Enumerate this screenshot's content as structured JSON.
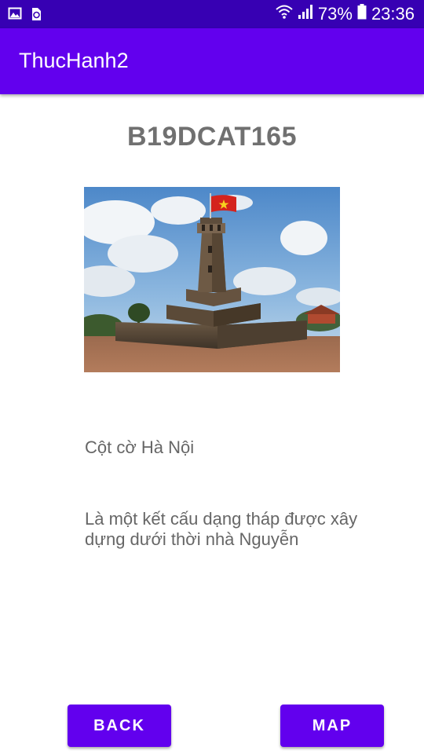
{
  "status_bar": {
    "battery_percent": "73%",
    "time": "23:36",
    "icons": [
      "image-icon",
      "recycle-icon",
      "wifi-icon",
      "signal-icon",
      "battery-icon"
    ]
  },
  "app_bar": {
    "title": "ThucHanh2"
  },
  "main": {
    "student_id": "B19DCAT165",
    "image_subject": "flag-tower-photo",
    "place_name": "Cột cờ Hà Nội",
    "description": "Là một kết cấu dạng tháp được xây dựng dưới thời nhà Nguyễn"
  },
  "buttons": {
    "back_label": "BACK",
    "map_label": "MAP"
  },
  "colors": {
    "status_bar": "#3700B3",
    "primary": "#6200EE",
    "text_gray": "#666666"
  }
}
